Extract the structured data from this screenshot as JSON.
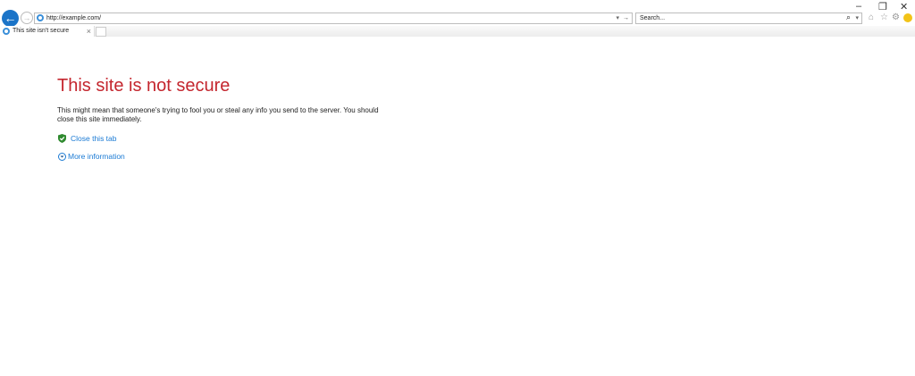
{
  "window": {
    "minimize": "–",
    "restore": "❐",
    "close": "✕"
  },
  "nav": {
    "back": "←",
    "forward": "→"
  },
  "address": {
    "url": "http://example.com/",
    "dropdown": "▾",
    "go": "→"
  },
  "search": {
    "placeholder": "Search...",
    "icon": "⌕",
    "dropdown": "▾"
  },
  "toolbar": {
    "home": "⌂",
    "favorites": "☆",
    "settings": "⚙"
  },
  "tab": {
    "title": "This site isn't secure",
    "close": "×"
  },
  "page": {
    "title": "This site is not secure",
    "description": "This might mean that someone's trying to fool you or steal any info you send to the server. You should close this site immediately.",
    "close_link": "Close this tab",
    "more_link": "More information"
  },
  "colors": {
    "title": "#c4262e",
    "link": "#1a7ad4",
    "back": "#1b74c8"
  }
}
